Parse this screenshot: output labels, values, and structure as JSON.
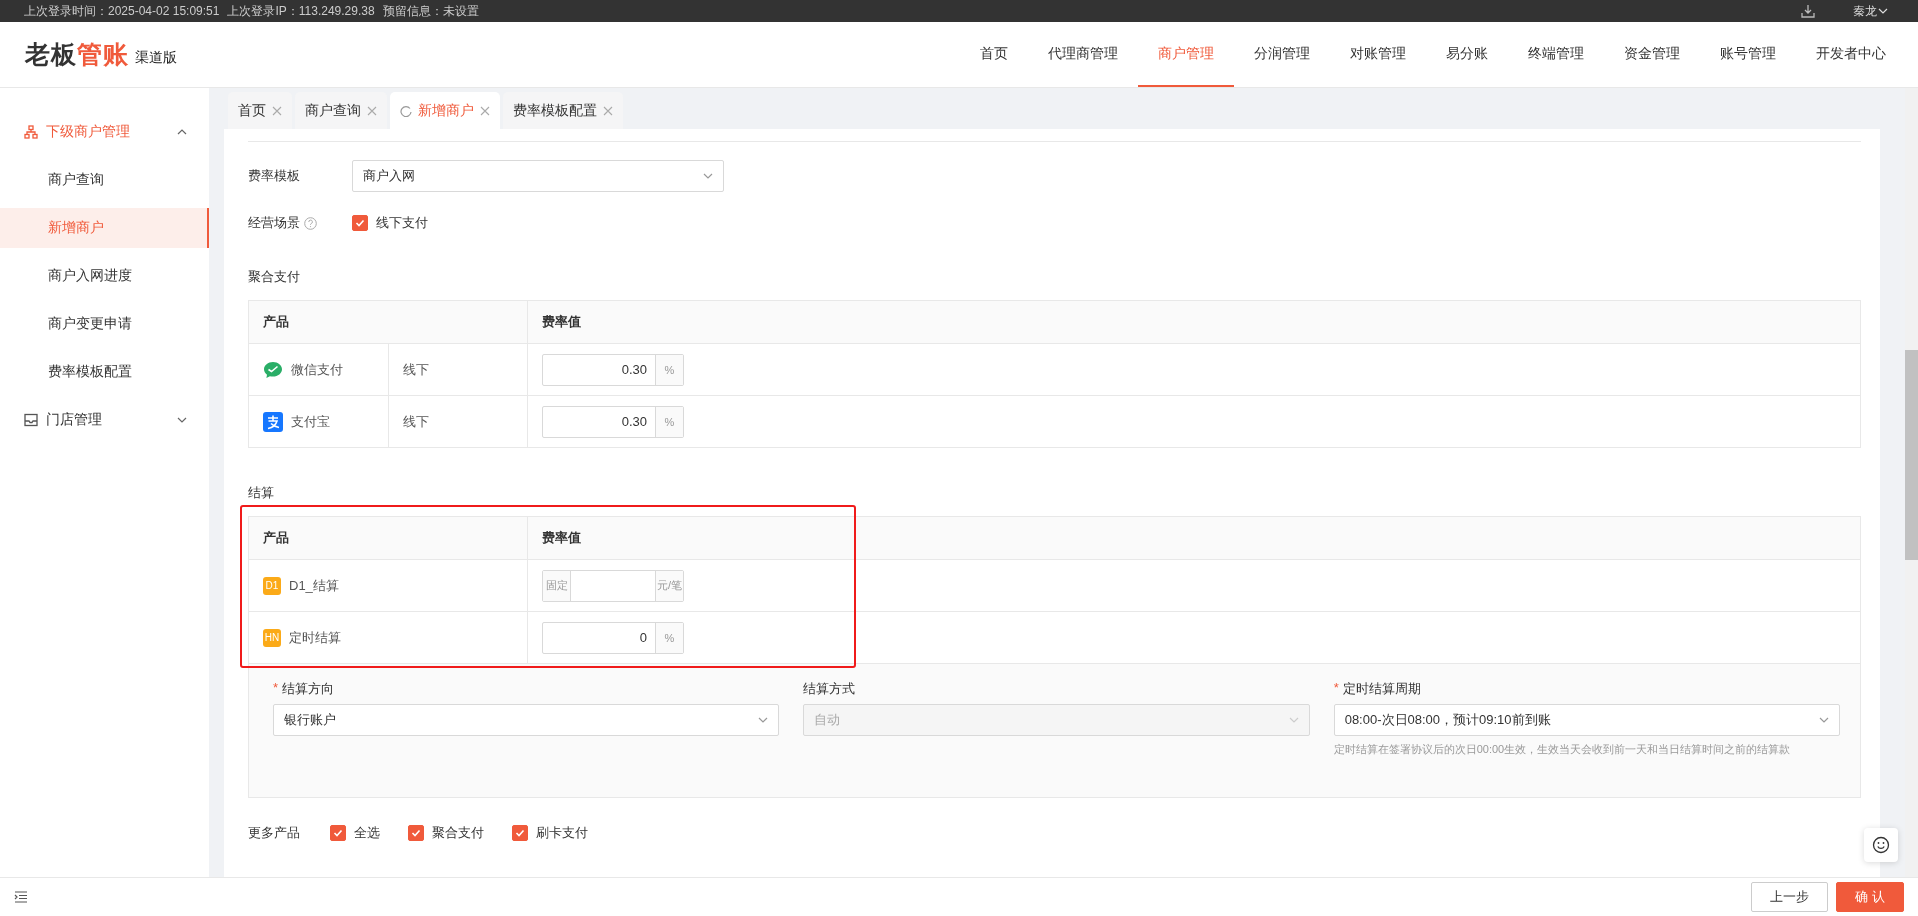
{
  "top_bar": {
    "login_time": "上次登录时间：2025-04-02 15:09:51",
    "login_ip": "上次登录IP：113.249.29.38",
    "reserved_info": "预留信息：未设置",
    "user": "秦龙"
  },
  "header": {
    "logo": {
      "dark": "老板",
      "accent": "管账",
      "edition": "渠道版"
    },
    "nav": [
      {
        "label": "首页",
        "selected": false
      },
      {
        "label": "代理商管理",
        "selected": false
      },
      {
        "label": "商户管理",
        "selected": true
      },
      {
        "label": "分润管理",
        "selected": false
      },
      {
        "label": "对账管理",
        "selected": false
      },
      {
        "label": "易分账",
        "selected": false
      },
      {
        "label": "终端管理",
        "selected": false
      },
      {
        "label": "资金管理",
        "selected": false
      },
      {
        "label": "账号管理",
        "selected": false
      },
      {
        "label": "开发者中心",
        "selected": false
      }
    ]
  },
  "sidebar": {
    "groups": [
      {
        "label": "下级商户管理",
        "kind": "hierarchy",
        "expanded": true,
        "children": [
          {
            "label": "商户查询",
            "selected": false
          },
          {
            "label": "新增商户",
            "selected": true
          },
          {
            "label": "商户入网进度",
            "selected": false
          },
          {
            "label": "商户变更申请",
            "selected": false
          },
          {
            "label": "费率模板配置",
            "selected": false
          }
        ]
      },
      {
        "label": "门店管理",
        "kind": "tray",
        "expanded": false
      }
    ]
  },
  "tabs": [
    {
      "label": "首页",
      "selected": false
    },
    {
      "label": "商户查询",
      "selected": false
    },
    {
      "label": "新增商户",
      "selected": true
    },
    {
      "label": "费率模板配置",
      "selected": false
    }
  ],
  "form": {
    "rate_template": {
      "label": "费率模板",
      "value": "商户入网"
    },
    "scene": {
      "label": "经营场景",
      "option": "线下支付",
      "checked": true
    },
    "aggregate": {
      "title": "聚合支付",
      "columns": [
        "产品",
        "费率值"
      ],
      "rows": [
        {
          "kind": "chat",
          "name": "微信支付",
          "scene": "线下",
          "rate": {
            "kind": "percent",
            "value": "0.30",
            "unit": "%"
          }
        },
        {
          "kind": "pay",
          "name": "支付宝",
          "scene": "线下",
          "rate": {
            "kind": "percent",
            "value": "0.30",
            "unit": "%"
          }
        }
      ]
    },
    "settlement": {
      "title": "结算",
      "highlighted": true,
      "columns": [
        "产品",
        "费率值"
      ],
      "rows": [
        {
          "badge": "D1",
          "name": "D1_结算",
          "rate": {
            "kind": "fixed",
            "prefix": "固定",
            "unit": "元/笔"
          }
        },
        {
          "badge": "HN",
          "name": "定时结算",
          "rate": {
            "kind": "percent",
            "value": "0",
            "unit": "%"
          }
        }
      ],
      "fields": [
        {
          "label": "结算方向",
          "required_mark": "*",
          "value": "银行账户",
          "disabled": false
        },
        {
          "label": "结算方式",
          "value": "自动",
          "disabled": true
        },
        {
          "label": "定时结算周期",
          "required_mark": "*",
          "value": "08:00-次日08:00，预计09:10前到账",
          "disabled": false,
          "help": "定时结算在签署协议后的次日00:00生效，生效当天会收到前一天和当日结算时间之前的结算款"
        }
      ]
    },
    "more_products": {
      "label": "更多产品",
      "options": [
        {
          "label": "全选",
          "checked": true
        },
        {
          "label": "聚合支付",
          "checked": true
        },
        {
          "label": "刷卡支付",
          "checked": true
        }
      ]
    }
  },
  "footer": {
    "buttons": [
      {
        "label": "上一步",
        "kind": "default"
      },
      {
        "label": "确 认",
        "kind": "primary"
      }
    ]
  }
}
